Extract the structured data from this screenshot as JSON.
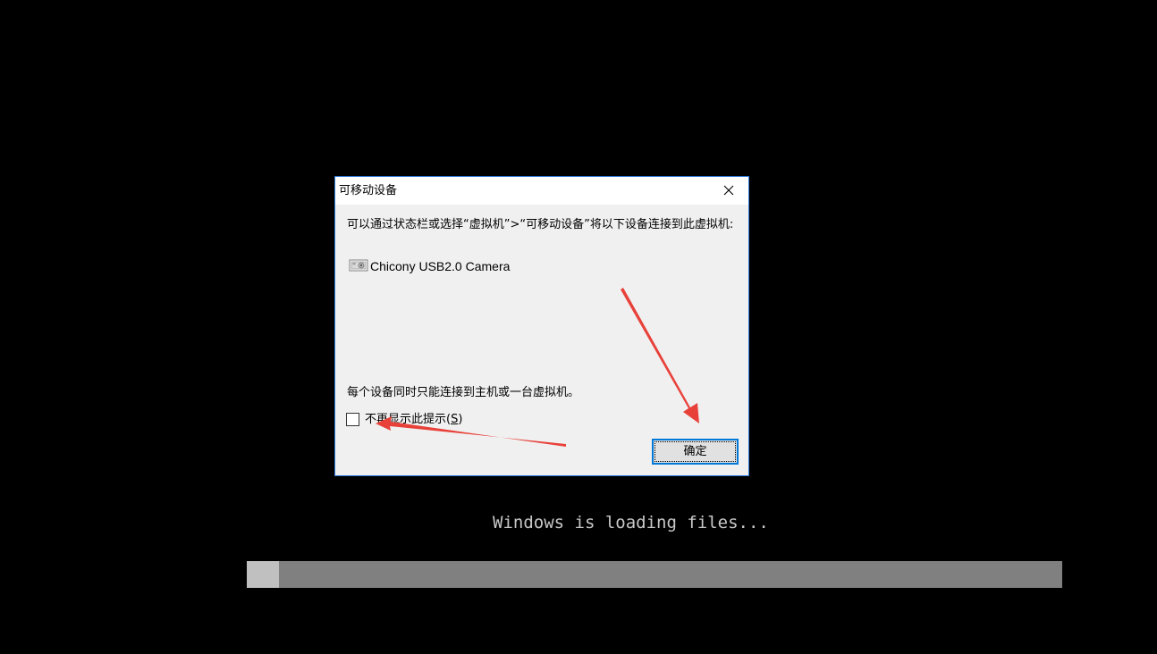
{
  "dialog": {
    "title": "可移动设备",
    "message": "可以通过状态栏或选择“虚拟机”>“可移动设备”将以下设备连接到此虚拟机:",
    "device": {
      "icon": "camera-icon",
      "name": "Chicony USB2.0 Camera"
    },
    "note": "每个设备同时只能连接到主机或一台虚拟机。",
    "checkbox": {
      "label": "不再显示此提示(",
      "accelerator": "S",
      "label_end": ")",
      "checked": false
    },
    "ok_label": "确定",
    "close_icon": "close-icon"
  },
  "boot": {
    "loading_text": "Windows is loading files...",
    "progress": 0.04
  },
  "colors": {
    "background": "#000000",
    "dialog_border": "#2b79d8",
    "annotation_arrow": "#e8413a",
    "progress_track": "#808080",
    "progress_fill": "#c0c0c0"
  }
}
